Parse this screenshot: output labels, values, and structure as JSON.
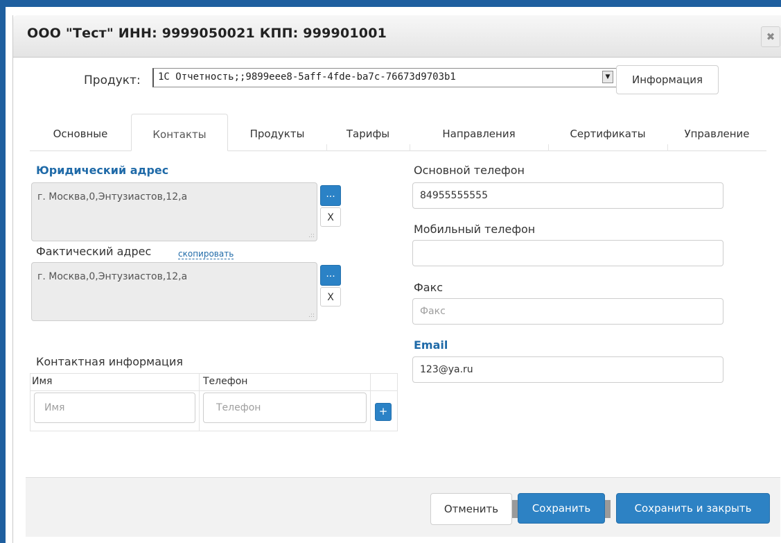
{
  "window": {
    "title": "ООО \"Тест\" ИНН: 9999050021 КПП: 999901001",
    "close_glyph": "✖"
  },
  "product": {
    "label": "Продукт:",
    "selected": "1С Отчетность;;9899eee8-5aff-4fde-ba7c-76673d9703b1",
    "info_button": "Информация"
  },
  "tabs": [
    {
      "label": "Основные",
      "active": false
    },
    {
      "label": "Контакты",
      "active": true
    },
    {
      "label": "Продукты",
      "active": false
    },
    {
      "label": "Тарифы",
      "active": false
    },
    {
      "label": "Направления",
      "active": false
    },
    {
      "label": "Сертификаты",
      "active": false
    },
    {
      "label": "Управление",
      "active": false
    }
  ],
  "legal_address": {
    "title": "Юридический адрес",
    "value": "г. Москва,0,Энтузиастов,12,а",
    "dots_button": "...",
    "clear_button": "X"
  },
  "actual_address": {
    "title": "Фактический адрес",
    "copy_link": "скопировать",
    "value": "г. Москва,0,Энтузиастов,12,а",
    "dots_button": "...",
    "clear_button": "X"
  },
  "contacts": {
    "title": "Контактная информация",
    "columns": [
      "Имя",
      "Телефон"
    ],
    "name_placeholder": "Имя",
    "phone_placeholder": "Телефон",
    "add_button": "+"
  },
  "phones": {
    "main_label": "Основной телефон",
    "main_value": "84955555555",
    "mobile_label": "Мобильный телефон",
    "mobile_value": "",
    "fax_label": "Факс",
    "fax_placeholder": "Факс",
    "email_label": "Email",
    "email_value": "123@ya.ru"
  },
  "footer": {
    "cancel": "Отменить",
    "save": "Сохранить",
    "save_close": "Сохранить и закрыть"
  },
  "colors": {
    "accent": "#2d82c4",
    "frame": "#1f5f9f",
    "section_title": "#1f6aa8"
  }
}
